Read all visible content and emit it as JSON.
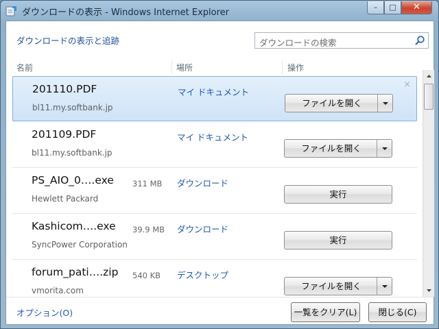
{
  "window": {
    "title": "ダウンロードの表示 - Windows Internet Explorer",
    "minimize_label": "–",
    "maximize_label": "□",
    "close_label": "✕"
  },
  "header": {
    "title": "ダウンロードの表示と追跡",
    "search_placeholder": "ダウンロードの検索"
  },
  "columns": [
    "名前",
    "場所",
    "操作"
  ],
  "downloads": [
    {
      "name": "201110.PDF",
      "size": "",
      "source": "bl11.my.softbank.jp",
      "location": "マイ ドキュメント",
      "action": "ファイルを開く",
      "split": true,
      "selected": true
    },
    {
      "name": "201109.PDF",
      "size": "",
      "source": "bl11.my.softbank.jp",
      "location": "マイ ドキュメント",
      "action": "ファイルを開く",
      "split": true,
      "selected": false
    },
    {
      "name": "PS_AIO_0….exe",
      "size": "311 MB",
      "source": "Hewlett Packard",
      "location": "ダウンロード",
      "action": "実行",
      "split": false,
      "selected": false
    },
    {
      "name": "Kashicom….exe",
      "size": "39.9 MB",
      "source": "SyncPower Corporation",
      "location": "ダウンロード",
      "action": "実行",
      "split": false,
      "selected": false
    },
    {
      "name": "forum_pati….zip",
      "size": "540 KB",
      "source": "vmorita.com",
      "location": "デスクトップ",
      "action": "ファイルを開く",
      "split": true,
      "selected": false
    }
  ],
  "footer": {
    "options_label": "オプション(O)",
    "clear_label": "一覧をクリア(L)",
    "close_label": "閉じる(C)"
  },
  "row_close_glyph": "×",
  "colors": {
    "accent_link": "#1e58b5",
    "selected_row": "#cfe3f7",
    "close_button": "#c7452e"
  }
}
